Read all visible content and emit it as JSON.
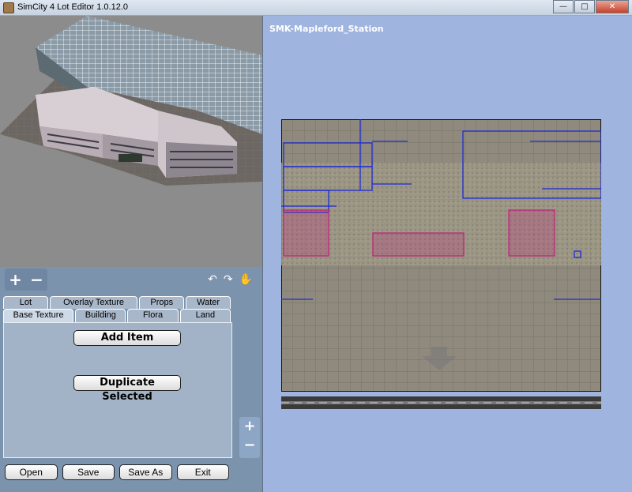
{
  "window": {
    "title": "SimCity 4 Lot Editor 1.0.12.0",
    "minimize_icon": "minimize-icon",
    "maximize_icon": "maximize-icon",
    "close_icon": "close-icon"
  },
  "editor": {
    "lot_name": "SMK-Mapleford_Station"
  },
  "zoom_controls": {
    "plus": "+",
    "minus": "−"
  },
  "tabs": {
    "row1": [
      {
        "label": "Lot"
      },
      {
        "label": "Overlay Texture"
      },
      {
        "label": "Props"
      },
      {
        "label": "Water"
      }
    ],
    "row2": [
      {
        "label": "Base Texture"
      },
      {
        "label": "Building"
      },
      {
        "label": "Flora"
      },
      {
        "label": "Land"
      }
    ],
    "active": "Base Texture"
  },
  "actions": {
    "add_item": "Add Item",
    "duplicate_selected": "Duplicate Selected"
  },
  "bottom_buttons": [
    {
      "label": "Open"
    },
    {
      "label": "Save"
    },
    {
      "label": "Save As"
    },
    {
      "label": "Exit"
    }
  ],
  "icons": {
    "rotate_left": "rotate-left-icon",
    "rotate_right": "rotate-right-icon",
    "hand": "hand-pan-icon"
  },
  "colors": {
    "panel_bg": "#7c93ad",
    "editor_bg": "#9fb4de",
    "selection_blue": "#1c2bd6",
    "selection_magenta": "#c0207a"
  }
}
